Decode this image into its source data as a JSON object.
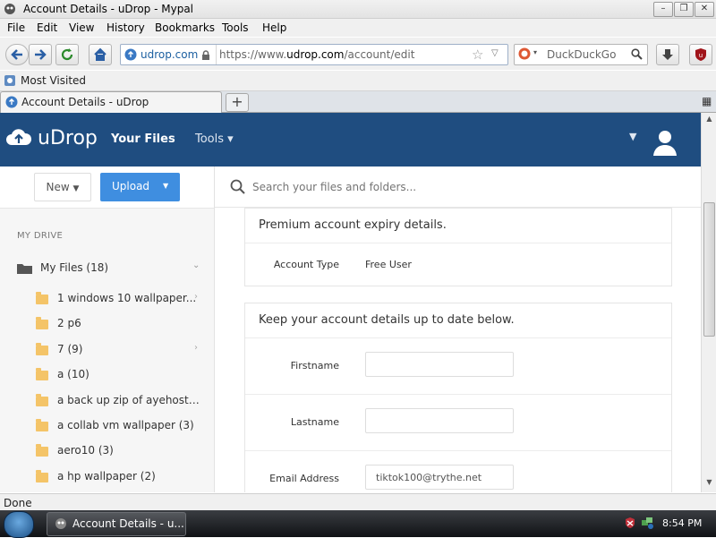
{
  "window": {
    "title": "Account Details - uDrop - Mypal"
  },
  "menus": [
    "File",
    "Edit",
    "View",
    "History",
    "Bookmarks",
    "Tools",
    "Help"
  ],
  "address": {
    "site": "udrop.com",
    "url_prefix": "https://www.",
    "url_domain": "udrop.com",
    "url_path": "/account/edit"
  },
  "search": {
    "engine_placeholder": "DuckDuckGo"
  },
  "bookmarks": {
    "most_visited": "Most Visited"
  },
  "tab": {
    "label": "Account Details - uDrop"
  },
  "app": {
    "logo": "uDrop",
    "nav_your_files": "Your Files",
    "nav_tools": "Tools",
    "new_label": "New",
    "upload_label": "Upload",
    "search_placeholder": "Search your files and folders...",
    "sidebar_heading": "MY DRIVE",
    "root": "My Files (18)",
    "folders": [
      "1 windows 10 wallpaper...",
      "2 p6",
      "7 (9)",
      "a (10)",
      "a back up zip of ayehosti...",
      "a collab vm wallpaper (3)",
      "aero10 (3)",
      "a hp wallpaper (2)"
    ]
  },
  "account": {
    "expiry_header": "Premium account expiry details.",
    "account_type_label": "Account Type",
    "account_type_value": "Free User",
    "details_header": "Keep your account details up to date below.",
    "firstname_label": "Firstname",
    "firstname_value": "",
    "lastname_label": "Lastname",
    "lastname_value": "",
    "email_label": "Email Address",
    "email_value": "tiktok100@trythe.net"
  },
  "status": {
    "text": "Done"
  },
  "taskbar": {
    "window_label": "Account Details - u...",
    "clock": "8:54 PM"
  },
  "colors": {
    "header_bg": "#1f4d80",
    "upload_button": "#3f8ee0",
    "folder": "#f4c468"
  }
}
